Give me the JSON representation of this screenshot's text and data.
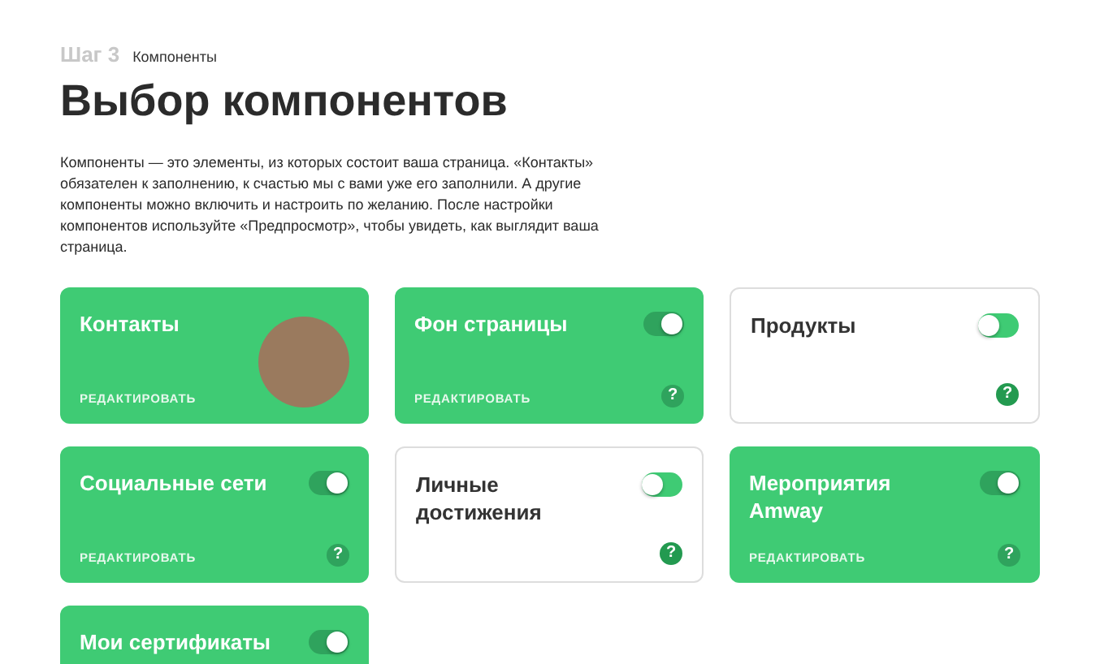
{
  "header": {
    "step": "Шаг 3",
    "section": "Компоненты",
    "title": "Выбор компонентов",
    "description": "Компоненты — это элементы, из которых состоит ваша страница. «Контакты» обязателен к заполнению, к счастью мы с вами уже его заполнили. А другие компоненты можно включить и настроить по желанию. После настройки компонентов используйте «Предпросмотр», чтобы увидеть, как выглядит ваша страница."
  },
  "components": [
    {
      "kind": "avatar",
      "title": "Контакты",
      "on": true,
      "edit": "РЕДАКТИРОВАТЬ"
    },
    {
      "kind": "toggle",
      "title": "Фон страницы",
      "on": true,
      "edit": "РЕДАКТИРОВАТЬ",
      "help": "?"
    },
    {
      "kind": "toggle",
      "title": "Продукты",
      "on": false,
      "help": "?"
    },
    {
      "kind": "toggle",
      "title": "Социальные сети",
      "on": true,
      "edit": "РЕДАКТИРОВАТЬ",
      "help": "?"
    },
    {
      "kind": "toggle",
      "title": "Личные достижения",
      "on": false,
      "help": "?"
    },
    {
      "kind": "toggle",
      "title": "Мероприятия Amway",
      "on": true,
      "edit": "РЕДАКТИРОВАТЬ",
      "help": "?"
    },
    {
      "kind": "toggle",
      "title": "Мои сертификаты",
      "on": true
    }
  ]
}
